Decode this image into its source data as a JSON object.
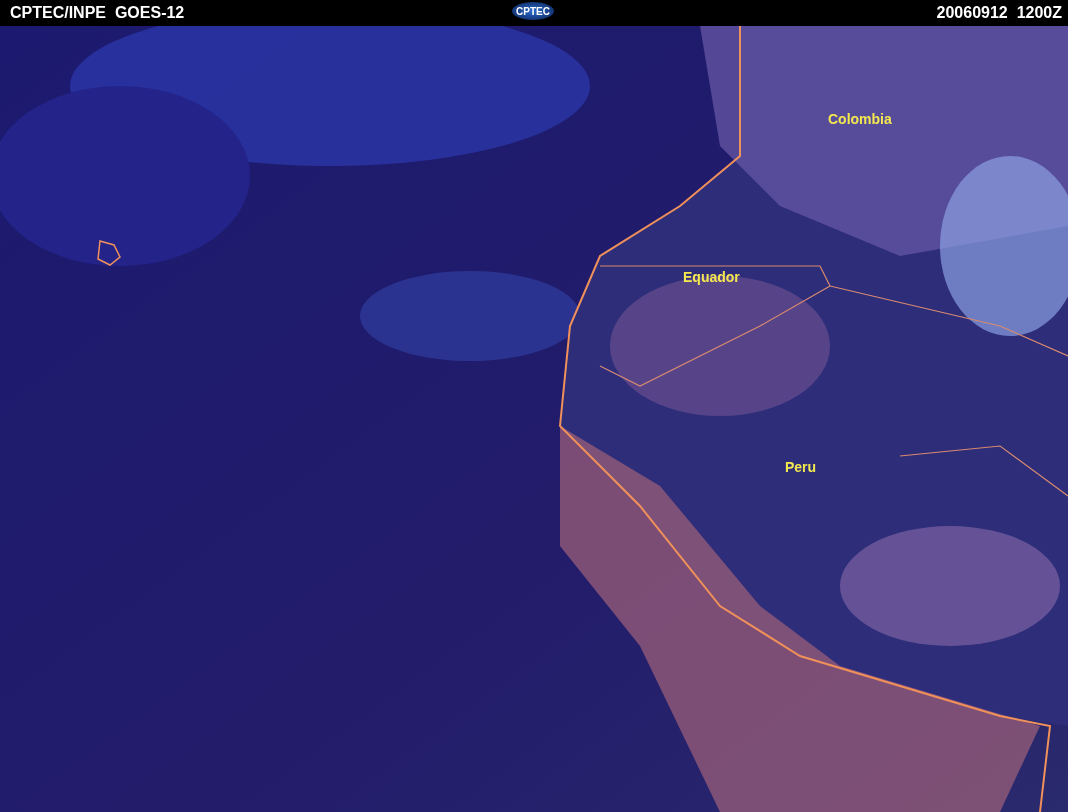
{
  "header": {
    "title": "CPTEC/INPE  GOES-12",
    "logo": "CPTEC",
    "timestamp": "20060912  1200Z"
  },
  "map": {
    "labels": [
      "Colombia",
      "Equador",
      "Peru"
    ]
  }
}
